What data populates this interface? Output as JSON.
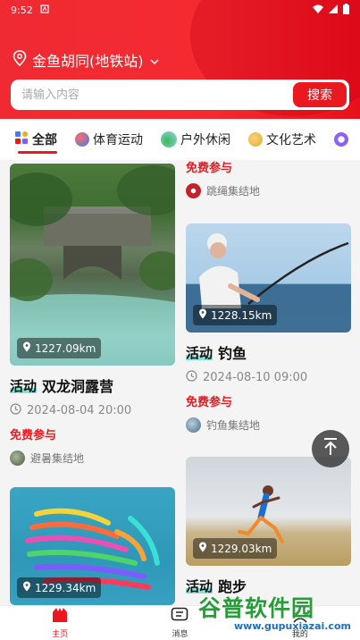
{
  "status_bar": {
    "time": "9:52"
  },
  "header": {
    "location": "金鱼胡同(地铁站)",
    "search_placeholder": "请输入内容",
    "search_button": "搜索"
  },
  "tabs": [
    {
      "label": "全部",
      "active": true
    },
    {
      "label": "体育运动",
      "active": false
    },
    {
      "label": "户外休闲",
      "active": false
    },
    {
      "label": "文化艺术",
      "active": false
    }
  ],
  "feed": {
    "left": [
      {
        "distance": "1227.09km",
        "tag": "活动",
        "title": "双龙洞露营",
        "time": "2024-08-04 20:00",
        "price": "免费参与",
        "place": "避暑集结地"
      },
      {
        "distance": "1229.34km"
      }
    ],
    "right": [
      {
        "price": "免费参与",
        "place": "跳绳集结地"
      },
      {
        "distance": "1228.15km",
        "tag": "活动",
        "title": "钓鱼",
        "time": "2024-08-10 09:00",
        "price": "免费参与",
        "place": "钓鱼集结地"
      },
      {
        "distance": "1229.03km",
        "tag": "活动",
        "title": "跑步"
      }
    ]
  },
  "bottom_nav": [
    {
      "label": "主页",
      "active": true
    },
    {
      "label": "消息",
      "active": false
    },
    {
      "label": "我的",
      "active": false
    }
  ],
  "watermark": {
    "name": "谷普软件园",
    "url": "www.gupuxiazai.com"
  },
  "colors": {
    "accent": "#e9191f",
    "tag_highlight": "#28d2be"
  }
}
